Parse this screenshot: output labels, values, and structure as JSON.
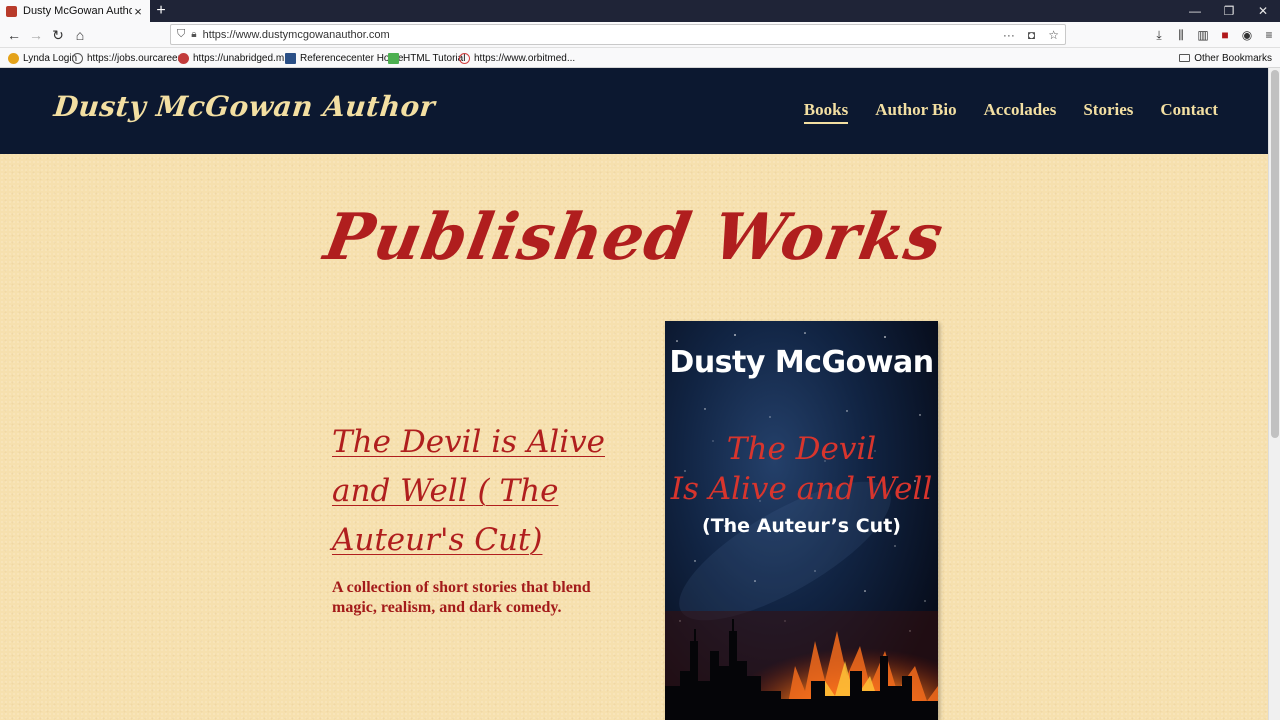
{
  "browser": {
    "tab_title": "Dusty McGowan Author",
    "new_tab": "+",
    "url": "https://www.dustymcgowanauthor.com",
    "window_buttons": [
      "—",
      "❐",
      "✕"
    ],
    "bookmarks": [
      {
        "label": "Lynda Login",
        "color": "#e4a21a"
      },
      {
        "label": "https://jobs.ourcareer...",
        "color": "#555555"
      },
      {
        "label": "https://unabridged.m...",
        "color": "#c23b3b"
      },
      {
        "label": "Referencecenter Home",
        "color": "#2a4f86"
      },
      {
        "label": "HTML Tutorial",
        "color": "#4caf50"
      },
      {
        "label": "https://www.orbitmed...",
        "color": "#d04040"
      }
    ],
    "other_bookmarks": "Other Bookmarks"
  },
  "site": {
    "logo": "Dusty McGowan Author",
    "nav": [
      {
        "label": "Books",
        "active": true
      },
      {
        "label": "Author Bio",
        "active": false
      },
      {
        "label": "Accolades",
        "active": false
      },
      {
        "label": "Stories",
        "active": false
      },
      {
        "label": "Contact",
        "active": false
      }
    ]
  },
  "main": {
    "heading": "Published Works",
    "book": {
      "title": "The Devil is Alive and Well ( The Auteur's Cut)",
      "description": "A collection of short stories that blend magic, realism, and dark comedy.",
      "cover": {
        "author": "Dusty McGowan",
        "title_line1": "The Devil",
        "title_line2": "Is Alive and Well",
        "subtitle": "(The Auteur’s Cut)"
      }
    }
  },
  "colors": {
    "header_bg": "#0c1830",
    "page_bg": "#f6e0ae",
    "accent_red": "#b01e1e",
    "nav_text": "#f3dfa2"
  }
}
